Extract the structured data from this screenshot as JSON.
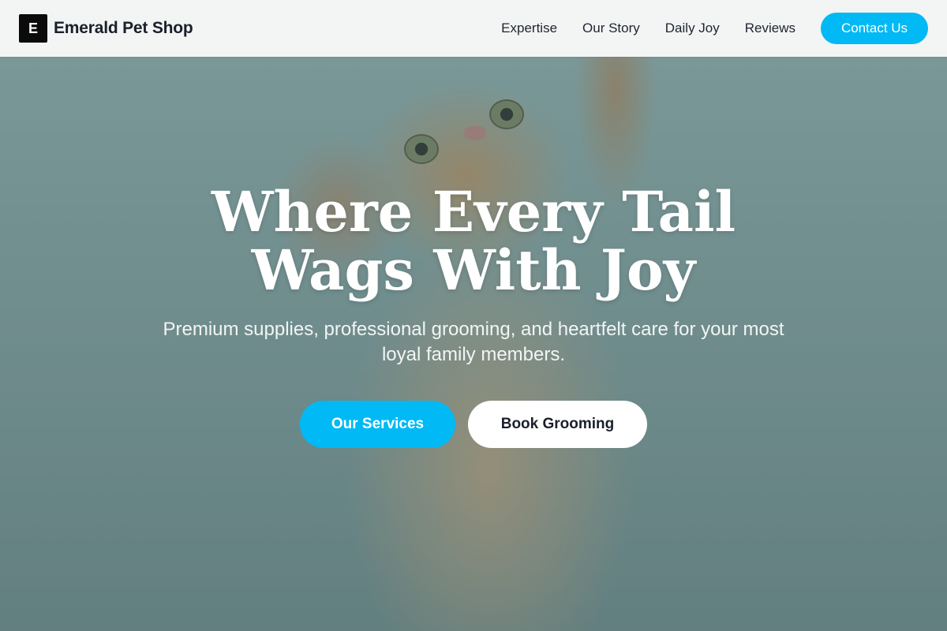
{
  "header": {
    "logo_mark": "E",
    "brand": "Emerald Pet Shop",
    "nav": [
      "Expertise",
      "Our Story",
      "Daily Joy",
      "Reviews"
    ],
    "contact_label": "Contact Us"
  },
  "hero": {
    "title": "Where Every Tail Wags With Joy",
    "subtitle": "Premium supplies, professional grooming, and heartfelt care for your most loyal family members.",
    "primary_cta": "Our Services",
    "secondary_cta": "Book Grooming",
    "image": "kitten-reaching-up"
  },
  "colors": {
    "accent": "#00b9f5",
    "header_bg": "#f3f4f4",
    "text_dark": "#1a1f2b"
  }
}
